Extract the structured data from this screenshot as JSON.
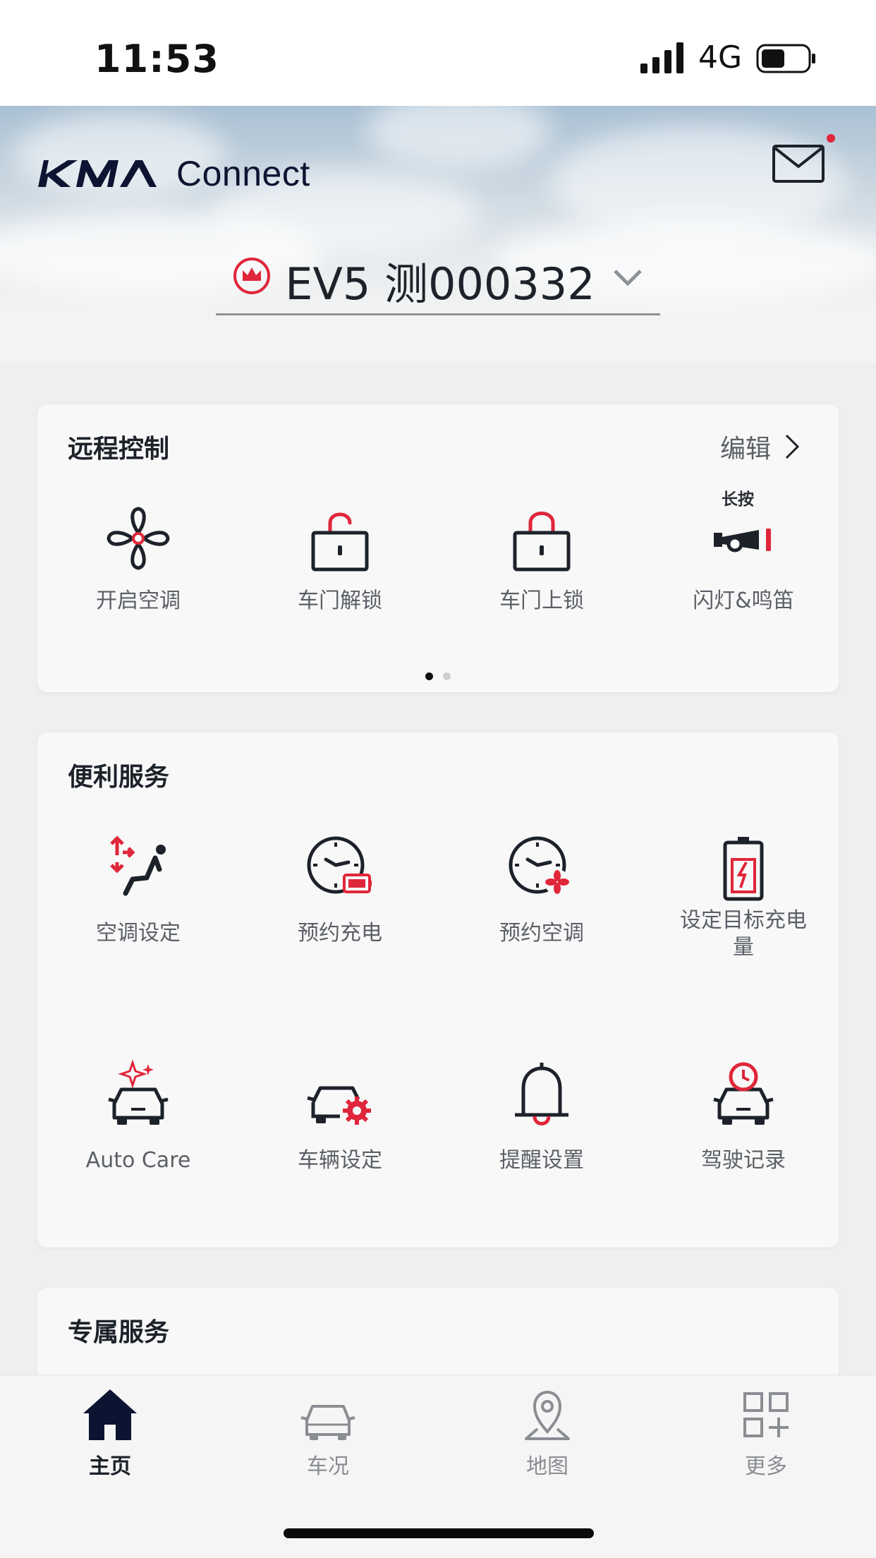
{
  "status_bar": {
    "time": "11:53",
    "network": "4G"
  },
  "header": {
    "brand_connect": "Connect",
    "vehicle_name": "EV5 测000332"
  },
  "remote_control": {
    "title": "远程控制",
    "edit_label": "编辑",
    "long_press_hint": "长按",
    "items": [
      {
        "label": "开启空调",
        "icon": "fan-icon"
      },
      {
        "label": "车门解锁",
        "icon": "unlock-icon"
      },
      {
        "label": "车门上锁",
        "icon": "lock-icon"
      },
      {
        "label": "闪灯&鸣笛",
        "icon": "horn-icon"
      }
    ],
    "pager": {
      "pages": 2,
      "current": 1
    }
  },
  "convenience": {
    "title": "便利服务",
    "items": [
      {
        "label": "空调设定",
        "icon": "seat-climate-icon"
      },
      {
        "label": "预约充电",
        "icon": "scheduled-charge-icon"
      },
      {
        "label": "预约空调",
        "icon": "scheduled-climate-icon"
      },
      {
        "label": "设定目标充电量",
        "icon": "battery-target-icon"
      },
      {
        "label": "Auto Care",
        "icon": "auto-care-icon"
      },
      {
        "label": "车辆设定",
        "icon": "car-settings-icon"
      },
      {
        "label": "提醒设置",
        "icon": "bell-icon"
      },
      {
        "label": "驾驶记录",
        "icon": "drive-record-icon"
      }
    ]
  },
  "exclusive": {
    "title": "专属服务"
  },
  "bottom_nav": {
    "items": [
      {
        "label": "主页",
        "icon": "home-icon",
        "active": true
      },
      {
        "label": "车况",
        "icon": "car-status-icon",
        "active": false
      },
      {
        "label": "地图",
        "icon": "map-pin-icon",
        "active": false
      },
      {
        "label": "更多",
        "icon": "more-grid-icon",
        "active": false
      }
    ]
  },
  "colors": {
    "accent_red": "#e0263a",
    "icon_dark": "#1d222a",
    "text_gray": "#5b5f66"
  }
}
